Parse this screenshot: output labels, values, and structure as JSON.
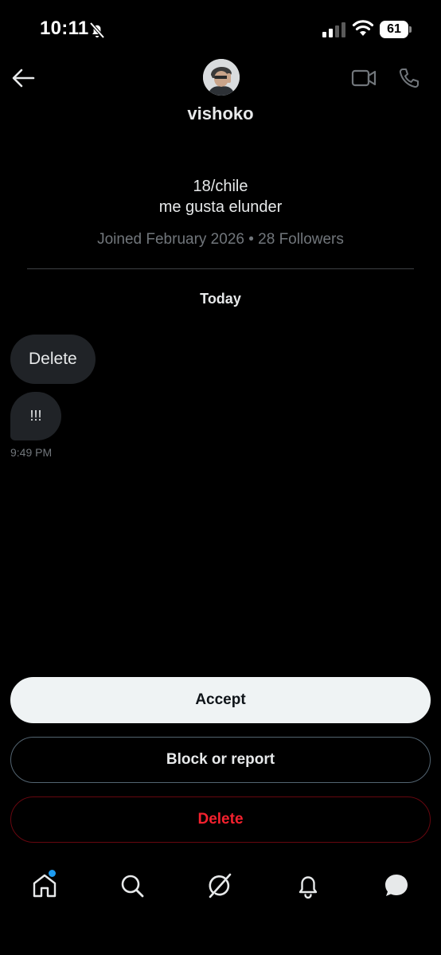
{
  "status_bar": {
    "time": "10:11",
    "battery": "61",
    "icons": [
      "bell-off-icon",
      "signal-icon",
      "wifi-icon",
      "battery-icon"
    ]
  },
  "header": {
    "username": "vishoko",
    "icons": [
      "back-arrow-icon",
      "video-call-icon",
      "phone-call-icon"
    ]
  },
  "profile": {
    "bio_line1": "18/chile",
    "bio_line2": "me gusta elunder",
    "meta": "Joined February 2026 • 28 Followers"
  },
  "conversation": {
    "day_label": "Today",
    "messages": [
      {
        "text": "Delete"
      },
      {
        "text": "!!!"
      }
    ],
    "time": "9:49 PM"
  },
  "actions": {
    "accept": "Accept",
    "block_or_report": "Block or report",
    "delete": "Delete"
  },
  "bottom_nav": {
    "items": [
      "home-icon",
      "search-icon",
      "grok-icon",
      "bell-icon",
      "messages-icon"
    ],
    "home_has_badge": true
  },
  "colors": {
    "background": "#000000",
    "text_primary": "#e7e9ea",
    "text_secondary": "#71767b",
    "bubble": "#202327",
    "accept_bg": "#eff3f4",
    "delete_red": "#f4212e",
    "badge_blue": "#1d9bf0"
  }
}
